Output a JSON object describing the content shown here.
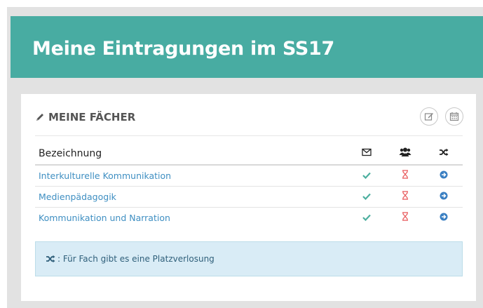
{
  "page": {
    "title": "Meine Eintragungen im SS17"
  },
  "panel": {
    "title": "MEINE FÄCHER",
    "icons": {
      "title": "pencil-icon",
      "edit_button": "edit-icon",
      "calendar_button": "calendar-icon"
    }
  },
  "table": {
    "columns": [
      {
        "label": "Bezeichnung"
      },
      {
        "icon": "envelope-icon"
      },
      {
        "icon": "users-icon"
      },
      {
        "icon": "shuffle-icon"
      }
    ],
    "rows": [
      {
        "name": "Interkulturelle Kommunikation",
        "status": [
          "check-icon",
          "hourglass-icon",
          "arrow-right-circle-icon"
        ]
      },
      {
        "name": "Medienpädagogik",
        "status": [
          "check-icon",
          "hourglass-icon",
          "arrow-right-circle-icon"
        ]
      },
      {
        "name": "Kommunikation und Narration",
        "status": [
          "check-icon",
          "hourglass-icon",
          "arrow-right-circle-icon"
        ]
      }
    ]
  },
  "info": {
    "icon": "shuffle-icon",
    "text": ": Für Fach gibt es eine Platzverlosung"
  },
  "colors": {
    "header": "#48aca2",
    "link": "#3f8fc2",
    "check": "#4caf9f",
    "hourglass": "#e8585a",
    "arrow": "#3a7fc2",
    "info_bg": "#d9ecf6"
  }
}
